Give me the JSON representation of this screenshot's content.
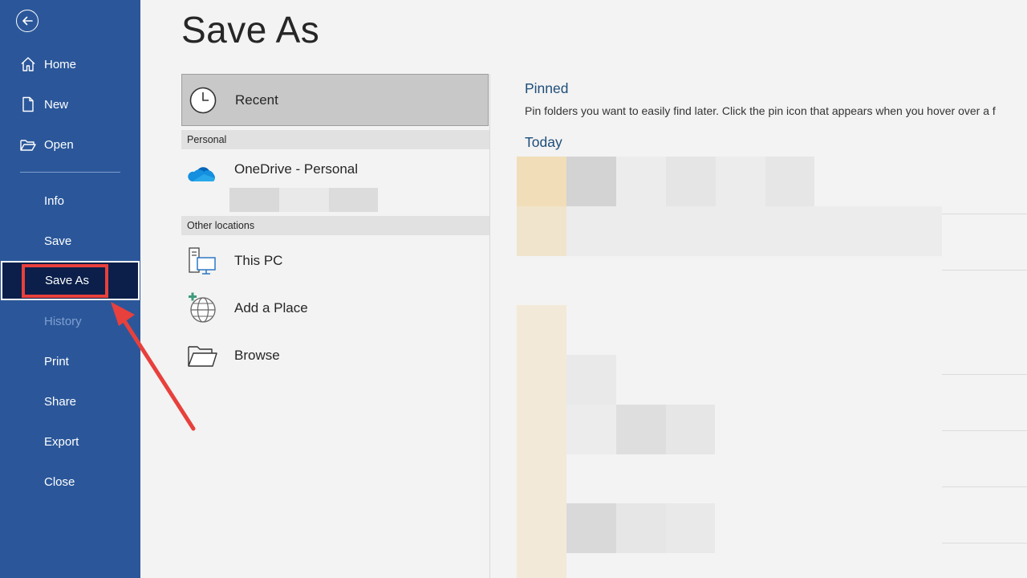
{
  "sidebar": {
    "back_icon": "back-arrow-icon",
    "items": [
      {
        "label": "Home",
        "icon": "home-icon"
      },
      {
        "label": "New",
        "icon": "new-document-icon"
      },
      {
        "label": "Open",
        "icon": "folder-open-icon"
      },
      {
        "label": "Info"
      },
      {
        "label": "Save"
      },
      {
        "label": "Save As"
      },
      {
        "label": "History"
      },
      {
        "label": "Print"
      },
      {
        "label": "Share"
      },
      {
        "label": "Export"
      },
      {
        "label": "Close"
      }
    ],
    "active_color": "#0b1f4a",
    "bg_color": "#2b579a"
  },
  "main": {
    "title": "Save As",
    "locations": {
      "recent": "Recent",
      "personal_header": "Personal",
      "onedrive": "OneDrive - Personal",
      "other_header": "Other locations",
      "this_pc": "This PC",
      "add_place": "Add a Place",
      "browse": "Browse"
    },
    "pinned": {
      "title": "Pinned",
      "description": "Pin folders you want to easily find later. Click the pin icon that appears when you hover over a f"
    },
    "today": {
      "title": "Today"
    }
  },
  "annotation": {
    "highlight_color": "#e8403c"
  }
}
